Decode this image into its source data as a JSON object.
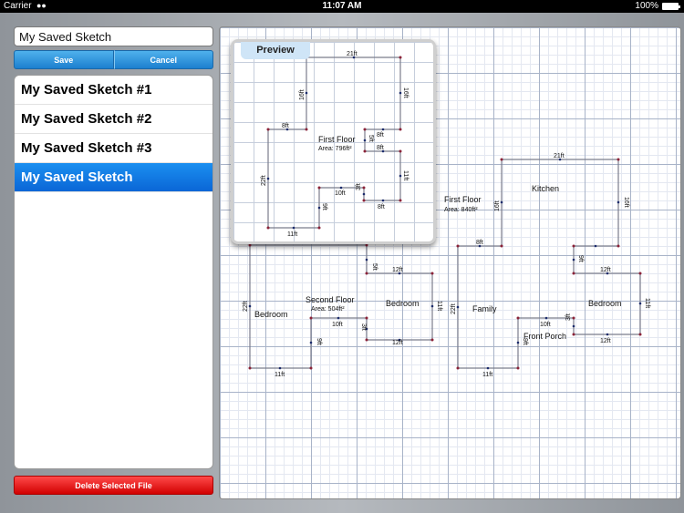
{
  "status": {
    "carrier": "Carrier",
    "time": "11:07 AM",
    "battery": "100%"
  },
  "form": {
    "name_value": "My Saved Sketch",
    "save_label": "Save",
    "cancel_label": "Cancel",
    "delete_label": "Delete Selected File"
  },
  "files": [
    "My Saved Sketch #1",
    "My Saved Sketch #2",
    "My Saved Sketch #3",
    "My Saved Sketch"
  ],
  "selected_index": 3,
  "preview": {
    "title": "Preview"
  },
  "colors": {
    "accent": "#1a83e6",
    "danger": "#e01010",
    "wall": "#7b7d8c",
    "vertex": "#8b2238"
  },
  "sketch": {
    "rooms": [
      "Bedroom",
      "Second Floor",
      "Bedroom",
      "Kitchen",
      "First Floor",
      "Family",
      "Bedroom",
      "Front Porch"
    ],
    "areas": [
      "Area: 504ft²",
      "Area: 840ft²"
    ],
    "dims": [
      "5ft",
      "12ft",
      "22ft",
      "11ft",
      "12ft",
      "10ft",
      "9ft",
      "3ft",
      "11ft",
      "21ft",
      "16ft",
      "8ft",
      "16ft",
      "22ft",
      "11ft",
      "9ft",
      "12ft",
      "11ft",
      "12ft",
      "10ft",
      "3ft",
      "9ft",
      "11ft",
      "11ft"
    ]
  },
  "preview_sketch": {
    "labels": [
      "First Floor",
      "Area: 796ft²"
    ],
    "dims": [
      "21ft",
      "16ft",
      "16ft",
      "8ft",
      "5ft",
      "8ft",
      "8ft",
      "22ft",
      "11ft",
      "10ft",
      "3ft",
      "9ft",
      "8ft",
      "11ft"
    ]
  }
}
